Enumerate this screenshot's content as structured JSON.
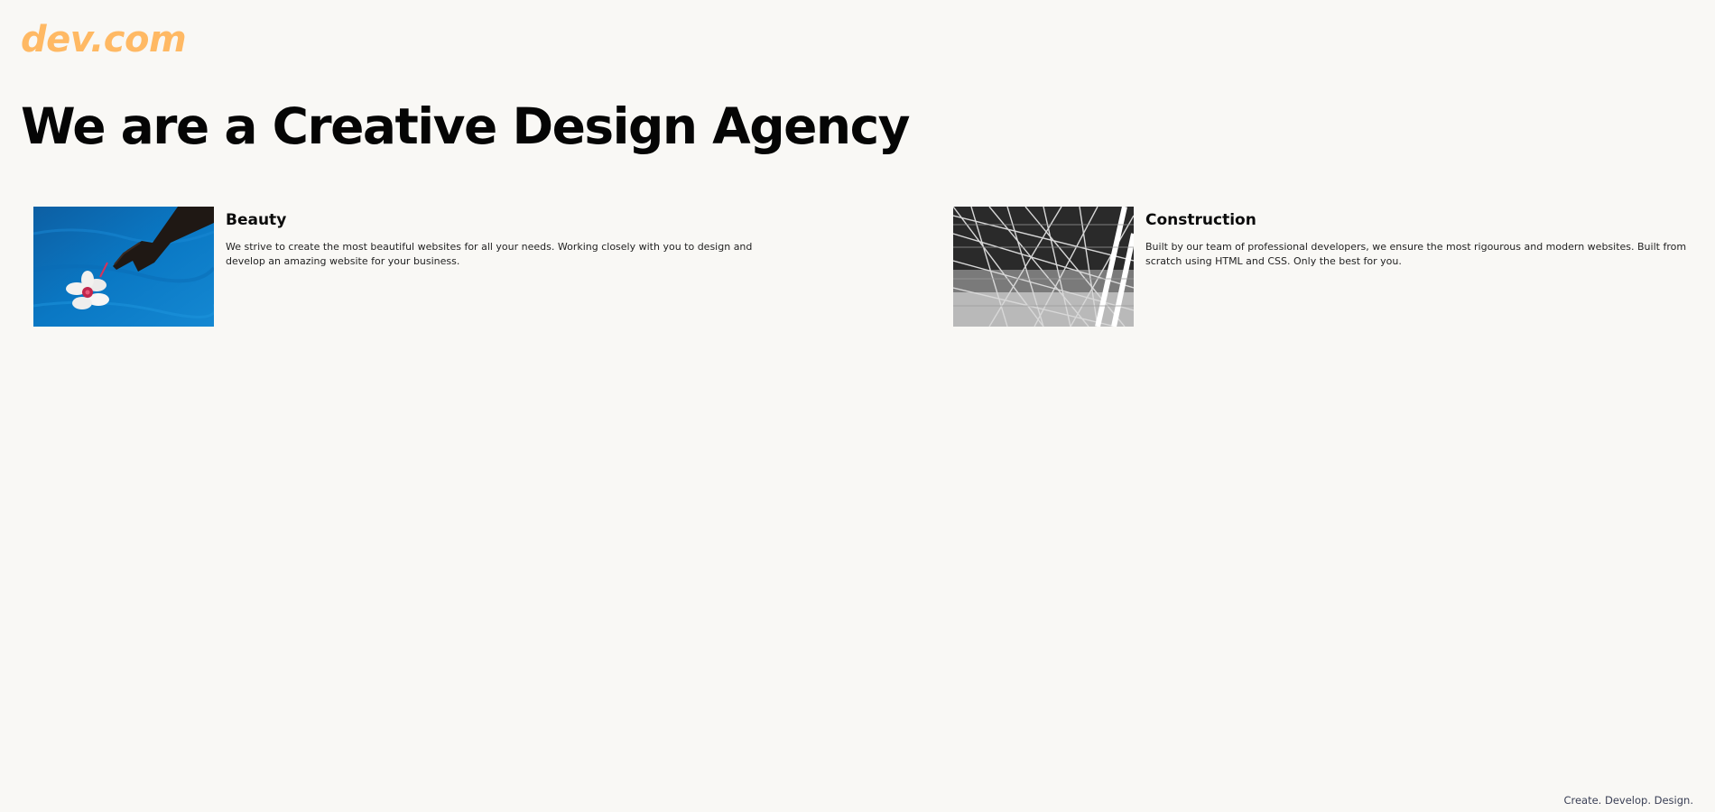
{
  "header": {
    "logo": "dev.com"
  },
  "hero": {
    "title": "We are a Creative Design Agency"
  },
  "services": [
    {
      "title": "Beauty",
      "text": "We strive to create the most beautiful websites for all your needs. Working closely with you to design and develop an amazing website for your business.",
      "image_icon": "flower-in-water-photo"
    },
    {
      "title": "Construction",
      "text": "Built by our team of professional developers, we ensure the most rigourous and modern websites. Built from scratch using HTML and CSS. Only the best for you.",
      "image_icon": "steel-structure-photo"
    }
  ],
  "footer": {
    "tagline": "Create. Develop. Design."
  },
  "colors": {
    "background": "#f9f8f5",
    "logo": "#ffb964",
    "heading": "#050505",
    "tagline": "#3a3f55"
  }
}
